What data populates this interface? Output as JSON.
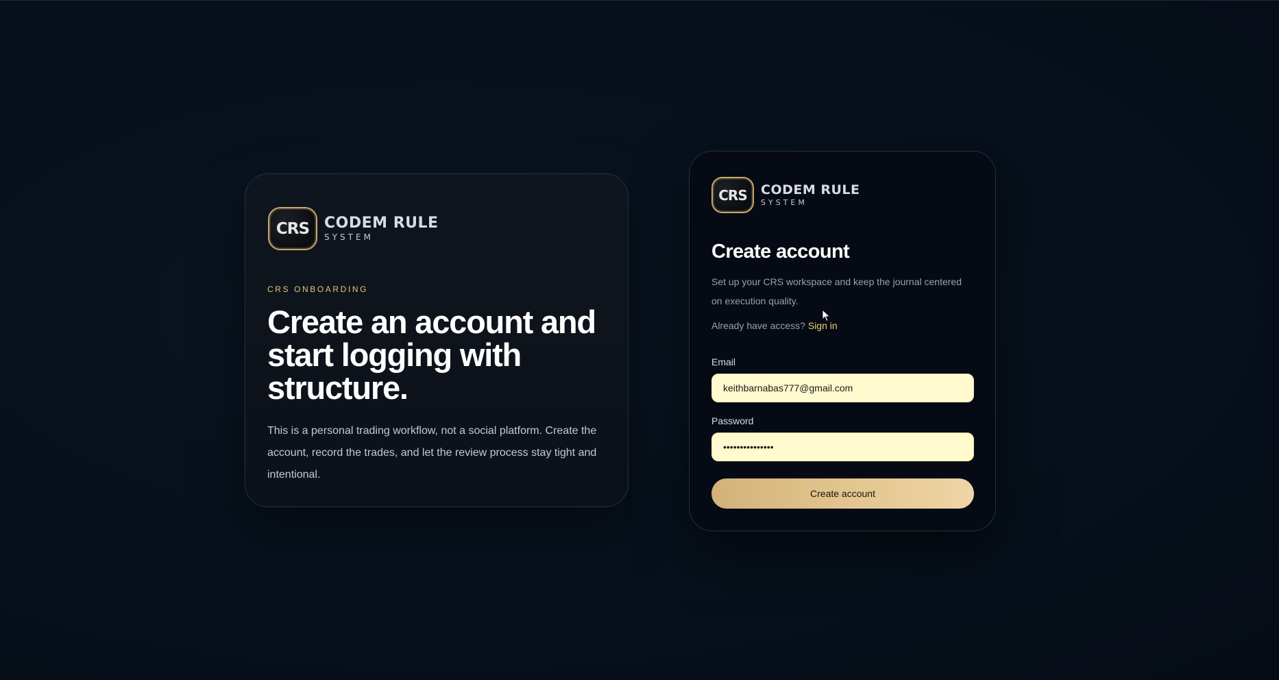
{
  "brand": {
    "badge_text": "CRS",
    "name": "CODEM RULE",
    "tagline": "SYSTEM",
    "accent_color": "#c9a96a"
  },
  "onboarding": {
    "eyebrow": "CRS ONBOARDING",
    "headline": "Create an account and start logging with structure.",
    "body": "This is a personal trading workflow, not a social platform. Create the account, record the trades, and let the review process stay tight and intentional."
  },
  "form": {
    "title": "Create account",
    "description": "Set up your CRS workspace and keep the journal centered on execution quality.",
    "access_prompt": "Already have access?",
    "sign_in_link": "Sign in",
    "email_label": "Email",
    "email_value": "keithbarnabas777@gmail.com",
    "password_label": "Password",
    "password_value": "supersecretpass",
    "submit_label": "Create account",
    "link_color": "#f2cf6b",
    "input_bg_color": "#fffbcf"
  }
}
